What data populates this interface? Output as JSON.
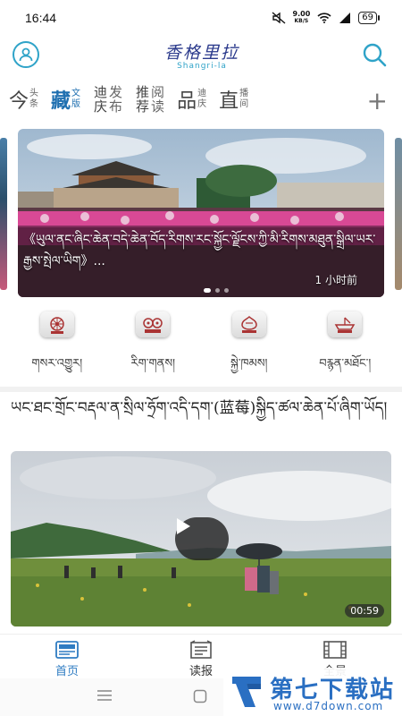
{
  "status_bar": {
    "time": "16:44",
    "net_speed_value": "9.00",
    "net_speed_unit": "KB/S",
    "battery": "69"
  },
  "header": {
    "logo_text": "香格里拉",
    "logo_subtext": "Shangri-la"
  },
  "tabs": [
    {
      "main": "今",
      "sub1": "头",
      "sub2": "条",
      "active": false
    },
    {
      "main": "藏",
      "sub1": "文",
      "sub2": "版",
      "active": true
    },
    {
      "main": "迪庆",
      "sub1": "发",
      "sub2": "布",
      "active": false
    },
    {
      "main": "推荐",
      "sub1": "阅",
      "sub2": "读",
      "active": false
    },
    {
      "main": "品",
      "sub1": "迪",
      "sub2": "庆",
      "active": false
    },
    {
      "main": "直",
      "sub1": "播",
      "sub2": "间",
      "active": false
    }
  ],
  "tabs_add": "+",
  "carousel": {
    "caption": "《ཡུལ་ནང་ཞིང་ཆེན་བདེ་ཆེན་བོད་རིགས་རང་སྐྱོང་ལྗོངས་ཀྱི་མི་རིགས་མཐུན་སྒྲིལ་ཡར་རྒྱས་སྤེལ་ཡིག》...",
    "time_ago": "1 小时前",
    "active_index": 0,
    "count": 3
  },
  "quicknav": [
    {
      "label": "གསར་འགྱུར།",
      "icon": "dharma-wheel-icon"
    },
    {
      "label": "རིག་གནས།",
      "icon": "double-fish-icon"
    },
    {
      "label": "སྐྱེ་ཁམས།",
      "icon": "vase-icon"
    },
    {
      "label": "བརྙན་མཐོང་།",
      "icon": "boat-icon"
    }
  ],
  "article": {
    "title": "ཡང་ཐང་གྲོང་བརྡལ་ན་སྲིལ་ཧྲོག་འདི་དག་(蓝莓)སྐྱིད་ཚལ་ཆེན་པོ་ཞིག་ཡོད།",
    "duration": "00:59"
  },
  "bottom_nav": [
    {
      "label": "首页",
      "icon": "news-icon",
      "active": true
    },
    {
      "label": "读报",
      "icon": "newspaper-icon",
      "active": false
    },
    {
      "label": "全景",
      "icon": "film-icon",
      "active": false
    }
  ],
  "watermark": {
    "title": "第七下载站",
    "url": "www.d7down.com"
  },
  "colors": {
    "accent": "#1e6fb0",
    "bottom_active": "#2f7cc2",
    "header_icon": "#2fa3c8"
  }
}
